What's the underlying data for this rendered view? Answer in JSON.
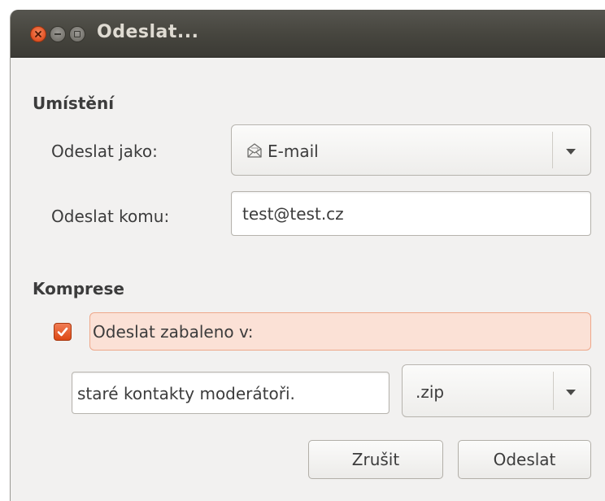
{
  "window": {
    "title": "Odeslat..."
  },
  "location_section": {
    "heading": "Umístění",
    "send_as": {
      "label": "Odeslat jako:",
      "value": "E-mail",
      "icon": "envelope-icon"
    },
    "send_to": {
      "label": "Odeslat komu:",
      "value": "test@test.cz"
    }
  },
  "compression_section": {
    "heading": "Komprese",
    "compress_checkbox": {
      "label": "Odeslat zabaleno v:",
      "checked": true
    },
    "archive_name": "staré kontakty moderátoři.",
    "archive_format": ".zip"
  },
  "actions": {
    "cancel_label": "Zrušit",
    "send_label": "Odeslat"
  },
  "colors": {
    "accent": "#dd4814",
    "titlebar": "#47463f",
    "background": "#f2f1f0"
  }
}
